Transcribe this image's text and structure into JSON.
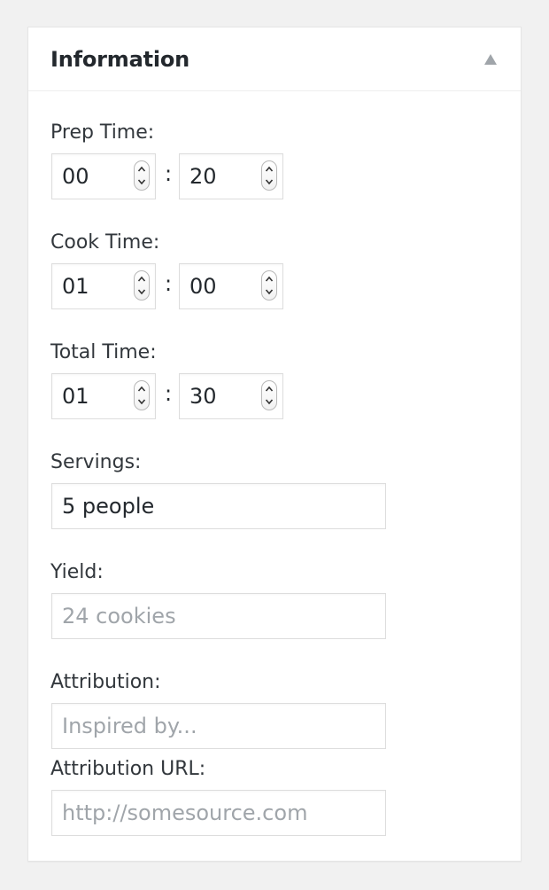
{
  "panel": {
    "title": "Information",
    "toggle_icon": "triangle-up-icon"
  },
  "fields": {
    "prep_time": {
      "label": "Prep Time:",
      "hours": "00",
      "minutes": "20",
      "separator": ":"
    },
    "cook_time": {
      "label": "Cook Time:",
      "hours": "01",
      "minutes": "00",
      "separator": ":"
    },
    "total_time": {
      "label": "Total Time:",
      "hours": "01",
      "minutes": "30",
      "separator": ":"
    },
    "servings": {
      "label": "Servings:",
      "value": "5 people",
      "placeholder": ""
    },
    "yield": {
      "label": "Yield:",
      "value": "",
      "placeholder": "24 cookies"
    },
    "attribution": {
      "label": "Attribution:",
      "value": "",
      "placeholder": "Inspired by..."
    },
    "attribution_url": {
      "label": "Attribution URL:",
      "value": "",
      "placeholder": "http://somesource.com"
    }
  }
}
